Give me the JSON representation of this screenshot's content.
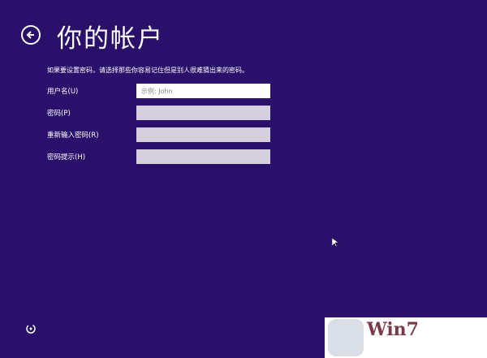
{
  "header": {
    "title": "你的帐户",
    "back_icon": "back-arrow-circle-icon"
  },
  "description": "如果要设置密码，请选择那些你容易记住但是别人很难猜出来的密码。",
  "fields": [
    {
      "label": "用户名(U)",
      "value": "",
      "placeholder": "示例: John"
    },
    {
      "label": "密码(P)",
      "value": "",
      "placeholder": ""
    },
    {
      "label": "重新输入密码(R)",
      "value": "",
      "placeholder": ""
    },
    {
      "label": "密码提示(H)",
      "value": "",
      "placeholder": ""
    }
  ],
  "watermark": {
    "text": "Win7"
  },
  "colors": {
    "background": "#2a0f6b",
    "input_active": "#ffffff",
    "input_inactive": "#d4d0dd"
  }
}
